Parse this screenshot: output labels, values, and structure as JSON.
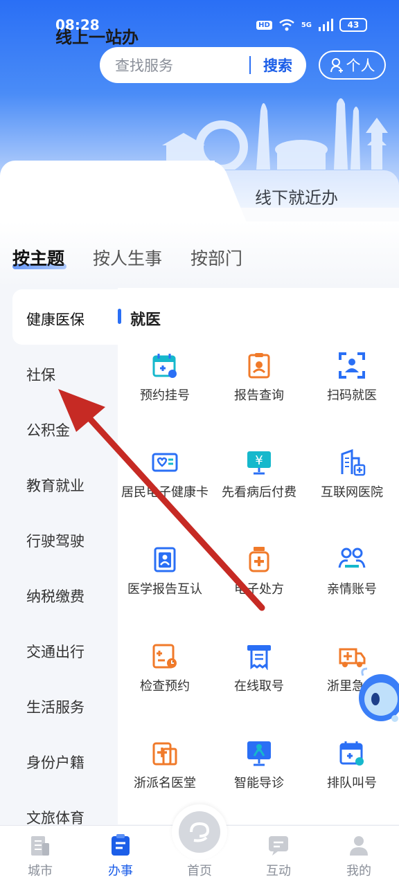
{
  "status_bar": {
    "time": "08:28",
    "hd": "HD",
    "network": "5G",
    "battery": "43"
  },
  "search": {
    "placeholder": "查找服务",
    "button_label": "搜索"
  },
  "personal": {
    "label": "个人"
  },
  "segments": {
    "online": "线上一站办",
    "offline": "线下就近办"
  },
  "category_tabs": [
    "按主题",
    "按人生事",
    "按部门"
  ],
  "side_menu": [
    "健康医保",
    "社保",
    "公积金",
    "教育就业",
    "行驶驾驶",
    "纳税缴费",
    "交通出行",
    "生活服务",
    "身份户籍",
    "文旅体育"
  ],
  "section": {
    "title": "就医"
  },
  "services": [
    {
      "label": "预约挂号",
      "icon": "calendar-plus-icon"
    },
    {
      "label": "报告查询",
      "icon": "report-icon"
    },
    {
      "label": "扫码就医",
      "icon": "scan-person-icon"
    },
    {
      "label": "居民电子健康卡",
      "icon": "health-card-icon"
    },
    {
      "label": "先看病后付费",
      "icon": "yuan-screen-icon"
    },
    {
      "label": "互联网医院",
      "icon": "hospital-building-icon"
    },
    {
      "label": "医学报告互认",
      "icon": "medical-report-icon"
    },
    {
      "label": "电子处方",
      "icon": "medicine-bottle-icon"
    },
    {
      "label": "亲情账号",
      "icon": "family-icon"
    },
    {
      "label": "检查预约",
      "icon": "exam-appointment-icon"
    },
    {
      "label": "在线取号",
      "icon": "ticket-icon"
    },
    {
      "label": "浙里急救",
      "icon": "ambulance-icon"
    },
    {
      "label": "浙派名医堂",
      "icon": "clinic-icon"
    },
    {
      "label": "智能导诊",
      "icon": "smart-guide-icon"
    },
    {
      "label": "排队叫号",
      "icon": "queue-calendar-icon"
    }
  ],
  "bottom_nav": [
    {
      "label": "城市",
      "icon": "city-icon"
    },
    {
      "label": "办事",
      "icon": "tasks-icon"
    },
    {
      "label": "首页",
      "icon": "home-logo-icon"
    },
    {
      "label": "互动",
      "icon": "chat-icon"
    },
    {
      "label": "我的",
      "icon": "profile-icon"
    }
  ],
  "colors": {
    "primary": "#2a6ff5",
    "orange": "#f07a2a",
    "cyan": "#16b8cc"
  }
}
